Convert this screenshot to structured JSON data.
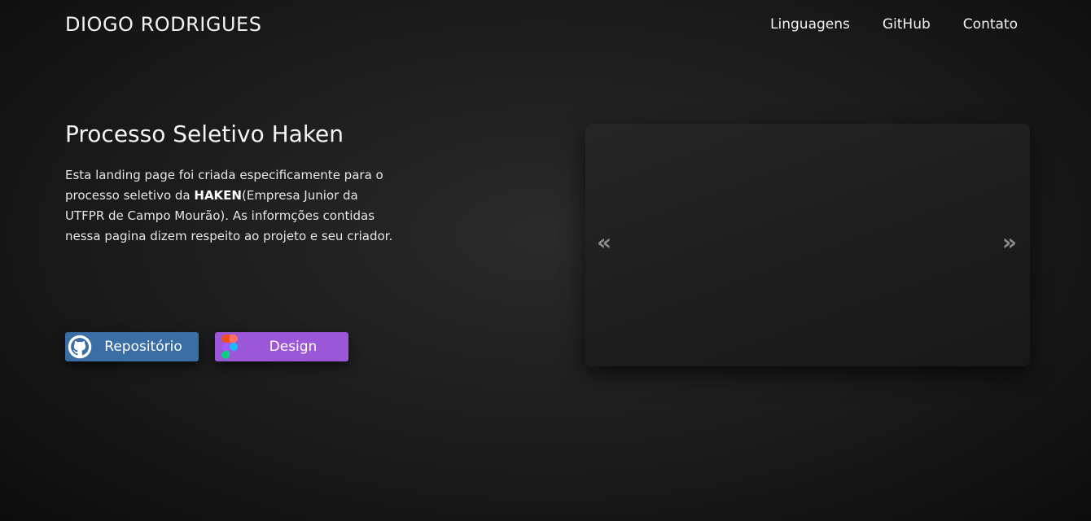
{
  "header": {
    "brand": "DIOGO RODRIGUES",
    "nav": [
      "Linguagens",
      "GitHub",
      "Contato"
    ]
  },
  "hero": {
    "title": "Processo Seletivo Haken",
    "description_before": "Esta landing page foi criada especificamente para o processo seletivo da ",
    "description_bold": "HAKEN",
    "description_after": "(Empresa Junior da UTFPR de Campo Mourão). As informções contidas nessa pagina dizem respeito ao projeto e seu criador."
  },
  "buttons": {
    "repo_label": "Repositório",
    "design_label": "Design"
  },
  "carousel": {
    "prev": "«",
    "next": "»"
  },
  "icons": [
    "github-icon",
    "figma-icon"
  ],
  "colors": {
    "background": "#1b1b1b",
    "repo_button": "#3a6ea5",
    "design_button": "#9a57d8",
    "text": "#ffffff"
  }
}
